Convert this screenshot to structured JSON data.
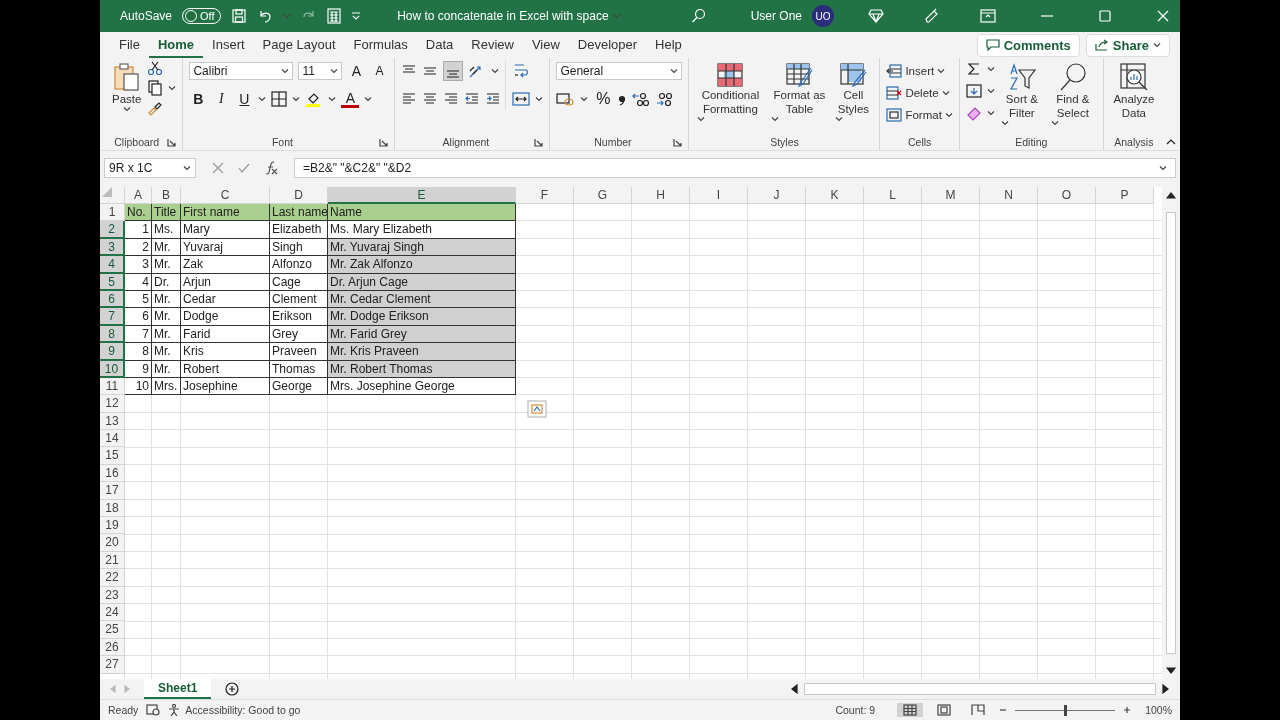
{
  "title_bar": {
    "autosave_label": "AutoSave",
    "autosave_on": false,
    "autosave_state": "Off",
    "title": "How to concatenate in Excel with space",
    "user_name": "User One",
    "user_initials": "UO"
  },
  "tabs": [
    {
      "label": "File",
      "selected": false
    },
    {
      "label": "Home",
      "selected": true
    },
    {
      "label": "Insert",
      "selected": false
    },
    {
      "label": "Page Layout",
      "selected": false
    },
    {
      "label": "Formulas",
      "selected": false
    },
    {
      "label": "Data",
      "selected": false
    },
    {
      "label": "Review",
      "selected": false
    },
    {
      "label": "View",
      "selected": false
    },
    {
      "label": "Developer",
      "selected": false
    },
    {
      "label": "Help",
      "selected": false
    }
  ],
  "comments": "Comments",
  "share": "Share",
  "ribbon": {
    "clipboard": {
      "paste": "Paste",
      "label": "Clipboard"
    },
    "font": {
      "name": "Calibri",
      "size": "11",
      "grow": "A",
      "shrink": "A",
      "bold": "B",
      "italic": "I",
      "underline": "U",
      "color_letter": "A",
      "label": "Font"
    },
    "alignment": {
      "label": "Alignment"
    },
    "number": {
      "format": "General",
      "percent": "%",
      "label": "Number"
    },
    "styles": {
      "buttons": [
        "Conditional Formatting",
        "Format as Table",
        "Cell Styles"
      ],
      "label": "Styles"
    },
    "cells": {
      "buttons": [
        "Insert",
        "Delete",
        "Format"
      ],
      "label": "Cells"
    },
    "editing": {
      "buttons": [
        "Sort & Filter",
        "Find & Select"
      ],
      "label": "Editing"
    },
    "analysis": {
      "button": "Analyze Data",
      "label": "Analysis"
    }
  },
  "formula_bar": {
    "name_box": "9R x 1C",
    "formula": "=B2&\" \"&C2&\" \"&D2"
  },
  "sheet": {
    "columns": [
      {
        "label": "A",
        "selected": false
      },
      {
        "label": "B",
        "selected": false
      },
      {
        "label": "C",
        "selected": false
      },
      {
        "label": "D",
        "selected": false
      },
      {
        "label": "E",
        "selected": true
      },
      {
        "label": "F",
        "selected": false
      },
      {
        "label": "G",
        "selected": false
      },
      {
        "label": "H",
        "selected": false
      },
      {
        "label": "I",
        "selected": false
      },
      {
        "label": "J",
        "selected": false
      },
      {
        "label": "K",
        "selected": false
      },
      {
        "label": "L",
        "selected": false
      },
      {
        "label": "M",
        "selected": false
      },
      {
        "label": "N",
        "selected": false
      },
      {
        "label": "O",
        "selected": false
      },
      {
        "label": "P",
        "selected": false
      }
    ],
    "rows": [
      {
        "number": "1",
        "kind": "header",
        "selected": false,
        "cells": [
          "No.",
          "Title",
          "First name",
          "Last name",
          "Name"
        ]
      },
      {
        "number": "2",
        "kind": "data",
        "selected": true,
        "active": true,
        "cells": [
          "1",
          "Ms.",
          "Mary",
          "Elizabeth",
          "Ms. Mary Elizabeth"
        ]
      },
      {
        "number": "3",
        "kind": "data",
        "selected": true,
        "cells": [
          "2",
          "Mr.",
          "Yuvaraj",
          "Singh",
          "Mr. Yuvaraj Singh"
        ]
      },
      {
        "number": "4",
        "kind": "data",
        "selected": true,
        "cells": [
          "3",
          "Mr.",
          "Zak",
          "Alfonzo",
          "Mr. Zak Alfonzo"
        ]
      },
      {
        "number": "5",
        "kind": "data",
        "selected": true,
        "cells": [
          "4",
          "Dr.",
          "Arjun",
          "Cage",
          "Dr. Arjun Cage"
        ]
      },
      {
        "number": "6",
        "kind": "data",
        "selected": true,
        "cells": [
          "5",
          "Mr.",
          "Cedar",
          "Clement",
          "Mr. Cedar Clement"
        ]
      },
      {
        "number": "7",
        "kind": "data",
        "selected": true,
        "cells": [
          "6",
          "Mr.",
          "Dodge",
          "Erikson",
          "Mr. Dodge Erikson"
        ]
      },
      {
        "number": "8",
        "kind": "data",
        "selected": true,
        "cells": [
          "7",
          "Mr.",
          "Farid",
          "Grey",
          "Mr. Farid Grey"
        ]
      },
      {
        "number": "9",
        "kind": "data",
        "selected": true,
        "cells": [
          "8",
          "Mr.",
          "Kris",
          "Praveen",
          "Mr. Kris Praveen"
        ]
      },
      {
        "number": "10",
        "kind": "data",
        "selected": true,
        "cells": [
          "9",
          "Mr.",
          "Robert",
          "Thomas",
          "Mr. Robert Thomas"
        ]
      },
      {
        "number": "11",
        "kind": "data",
        "selected": false,
        "cells": [
          "10",
          "Mrs.",
          "Josephine",
          "George",
          "Mrs. Josephine George"
        ]
      },
      {
        "number": "12",
        "selected": false
      },
      {
        "number": "13",
        "selected": false
      },
      {
        "number": "14",
        "selected": false
      },
      {
        "number": "15",
        "selected": false
      },
      {
        "number": "16",
        "selected": false
      },
      {
        "number": "17",
        "selected": false
      },
      {
        "number": "18",
        "selected": false
      },
      {
        "number": "19",
        "selected": false
      },
      {
        "number": "20",
        "selected": false
      },
      {
        "number": "21",
        "selected": false
      },
      {
        "number": "22",
        "selected": false
      },
      {
        "number": "23",
        "selected": false
      },
      {
        "number": "24",
        "selected": false
      },
      {
        "number": "25",
        "selected": false
      },
      {
        "number": "26",
        "selected": false
      },
      {
        "number": "27",
        "selected": false
      }
    ]
  },
  "sheet_tabs": [
    {
      "label": "Sheet1",
      "selected": true
    }
  ],
  "status_bar": {
    "mode": "Ready",
    "accessibility": "Accessibility: Good to go",
    "count": "Count: 9",
    "zoom": "100%",
    "zoom_slider": {
      "level": 0.5
    }
  }
}
